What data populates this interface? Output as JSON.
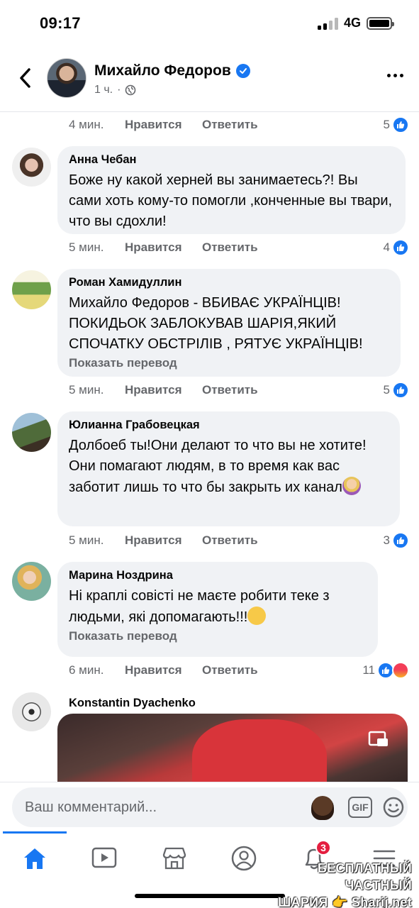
{
  "status_bar": {
    "time": "09:17",
    "network": "4G"
  },
  "header": {
    "author": "Михайло Федоров",
    "time": "1 ч.",
    "audience_icon": "globe-icon"
  },
  "top_actions": {
    "time": "4 мин.",
    "like": "Нравится",
    "reply": "Ответить",
    "reactions": "5"
  },
  "comments": [
    {
      "name": "Анна Чебан",
      "text": "Боже ну какой херней вы занимаетесь?! Вы сами хоть кому-то помогли ,конченные вы твари, что вы сдохли!",
      "time": "5 мин.",
      "like": "Нравится",
      "reply": "Ответить",
      "reactions": "4"
    },
    {
      "name": "Роман Хамидуллин",
      "text": "Михайло Федоров - ВБИВАЄ УКРАЇНЦІВ! ПОКИДЬОК ЗАБЛОКУВАВ ШАРІЯ,ЯКИЙ СПОЧАТКУ ОБСТРІЛІВ , РЯТУЄ УКРАЇНЦІВ!",
      "translate": "Показать перевод",
      "time": "5 мин.",
      "like": "Нравится",
      "reply": "Ответить",
      "reactions": "5"
    },
    {
      "name": "Юлианна Грабовецкая",
      "text": "Долбоеб ты!Они делают то что вы не хотите!Они помагают людям, в то время как вас заботит лишь то что бы закрыть их канал",
      "time": "5 мин.",
      "like": "Нравится",
      "reply": "Ответить",
      "reactions": "3"
    },
    {
      "name": "Марина Ноздрина",
      "text": "Ні краплі совісті не маєте робити теке з людьми, які допомагають!!!",
      "translate": "Показать перевод",
      "time": "6 мин.",
      "like": "Нравится",
      "reply": "Ответить",
      "reactions": "11"
    },
    {
      "name": "Konstantin  Dyachenko"
    }
  ],
  "composer": {
    "placeholder": "Ваш комментарий...",
    "gif_label": "GIF"
  },
  "tabs": {
    "notifications_badge": "3"
  },
  "watermark": {
    "line1": "БЕСПЛАТНЫЙ ЧАСТНЫЙ",
    "line2": "ШАРИЯ",
    "line3": "Sharij.net"
  },
  "colors": {
    "accent": "#1877f2",
    "bubble": "#f0f2f5",
    "secondary_text": "#65676b",
    "badge": "#e41e3f"
  }
}
